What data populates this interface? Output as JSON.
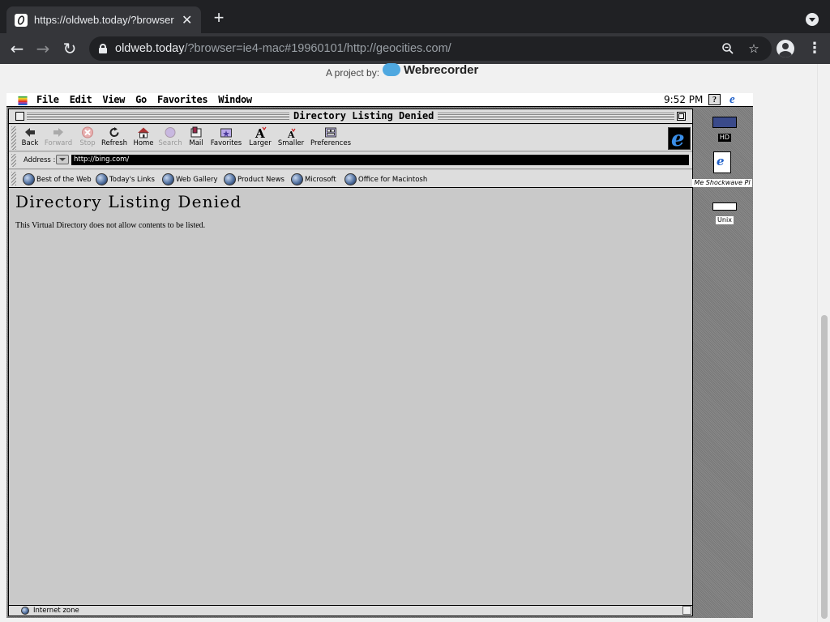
{
  "chrome": {
    "tab_title": "https://oldweb.today/?browser",
    "url_host": "oldweb.today",
    "url_rest": "/?browser=ie4-mac#19960101/http://geocities.com/"
  },
  "banner": {
    "project_by": "A project by:",
    "brand": "Webrecorder"
  },
  "mac": {
    "menu": [
      "File",
      "Edit",
      "View",
      "Go",
      "Favorites",
      "Window"
    ],
    "clock": "9:52 PM",
    "help_glyph": "?",
    "ie_glyph": "e"
  },
  "ie": {
    "window_title": "Directory Listing Denied",
    "toolbar": {
      "back": "Back",
      "forward": "Forward",
      "stop": "Stop",
      "refresh": "Refresh",
      "home": "Home",
      "search": "Search",
      "mail": "Mail",
      "favorites": "Favorites",
      "larger": "Larger",
      "smaller": "Smaller",
      "preferences": "Preferences"
    },
    "address_label": "Address :",
    "address_value": "http://bing.com/",
    "links": [
      "Best of the Web",
      "Today's Links",
      "Web Gallery",
      "Product News",
      "Microsoft",
      "Office for Macintosh"
    ],
    "page_heading": "Directory Listing Denied",
    "page_text": "This Virtual Directory does not allow contents to be listed.",
    "status": "Internet zone"
  },
  "desktop_icons": {
    "hd": "HD",
    "shockwave": "Me Shockwave Pl",
    "unix": "Unix"
  }
}
